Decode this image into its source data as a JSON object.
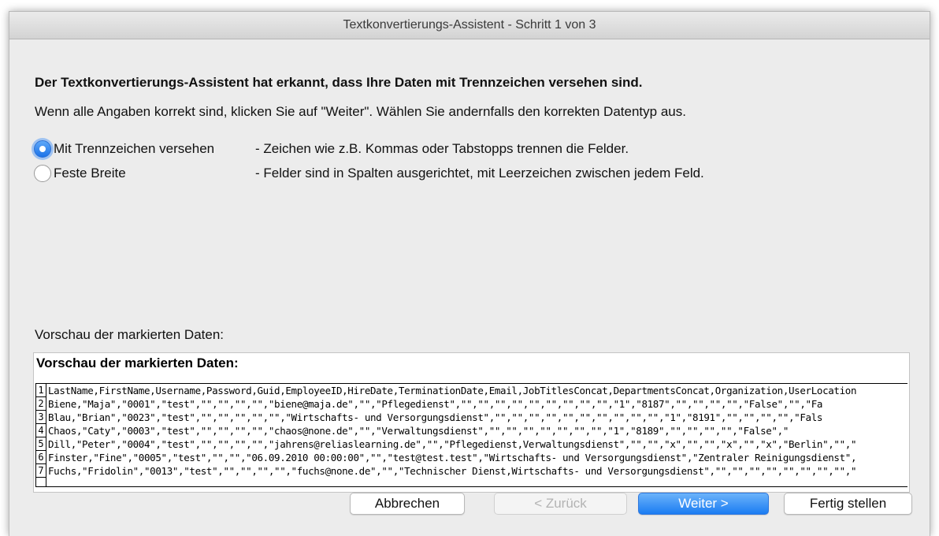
{
  "window": {
    "title": "Textkonvertierungs-Assistent - Schritt 1 von 3"
  },
  "heading": "Der Textkonvertierungs-Assistent hat erkannt, dass Ihre Daten mit Trennzeichen versehen sind.",
  "subtext": "Wenn alle Angaben korrekt sind, klicken Sie auf \"Weiter\". Wählen Sie andernfalls den korrekten Datentyp aus.",
  "options": [
    {
      "label": "Mit Trennzeichen versehen",
      "description": "- Zeichen wie z.B. Kommas oder Tabstopps trennen die Felder.",
      "selected": true
    },
    {
      "label": "Feste Breite",
      "description": "- Felder sind in Spalten ausgerichtet, mit Leerzeichen zwischen jedem Feld.",
      "selected": false
    }
  ],
  "preview": {
    "caption": "Vorschau der markierten Daten:",
    "title": "Vorschau der markierten Daten:",
    "lines": [
      {
        "num": "1",
        "text": "LastName,FirstName,Username,Password,Guid,EmployeeID,HireDate,TerminationDate,Email,JobTitlesConcat,DepartmentsConcat,Organization,UserLocation"
      },
      {
        "num": "2",
        "text": "Biene,\"Maja\",\"0001\",\"test\",\"\",\"\",\"\",\"\",\"biene@maja.de\",\"\",\"Pflegedienst\",\"\",\"\",\"\",\"\",\"\",\"\",\"\",\"\",\"\",\"1\",\"8187\",\"\",\"\",\"\",\"\",\"False\",\"\",\"Fa"
      },
      {
        "num": "3",
        "text": "Blau,\"Brian\",\"0023\",\"test\",\"\",\"\",\"\",\"\",\"\",\"Wirtschafts- und Versorgungsdienst\",\"\",\"\",\"\",\"\",\"\",\"\",\"\",\"\",\"\",\"\",\"1\",\"8191\",\"\",\"\",\"\",\"\",\"Fals"
      },
      {
        "num": "4",
        "text": "Chaos,\"Caty\",\"0003\",\"test\",\"\",\"\",\"\",\"\",\"chaos@none.de\",\"\",\"Verwaltungsdienst\",\"\",\"\",\"\",\"\",\"\",\"\",\"\",\"1\",\"8189\",\"\",\"\",\"\",\"\",\"False\",\""
      },
      {
        "num": "5",
        "text": "Dill,\"Peter\",\"0004\",\"test\",\"\",\"\",\"\",\"\",\"jahrens@reliaslearning.de\",\"\",\"Pflegedienst,Verwaltungsdienst\",\"\",\"\",\"x\",\"\",\"\",\"x\",\"\",\"x\",\"Berlin\",\"\",\""
      },
      {
        "num": "6",
        "text": "Finster,\"Fine\",\"0005\",\"test\",\"\",\"\",\"06.09.2010 00:00:00\",\"\",\"test@test.test\",\"Wirtschafts- und Versorgungsdienst\",\"Zentraler Reinigungsdienst\","
      },
      {
        "num": "7",
        "text": "Fuchs,\"Fridolin\",\"0013\",\"test\",\"\",\"\",\"\",\"\",\"fuchs@none.de\",\"\",\"Technischer Dienst,Wirtschafts- und Versorgungsdienst\",\"\",\"\",\"\",\"\",\"\",\"\",\"\",\"\",\""
      },
      {
        "num": "",
        "text": ""
      }
    ]
  },
  "buttons": {
    "cancel": "Abbrechen",
    "back": "< Zurück",
    "next": "Weiter >",
    "finish": "Fertig stellen"
  },
  "colors": {
    "accent": "#1a7cf2",
    "window_bg": "#ececec"
  }
}
